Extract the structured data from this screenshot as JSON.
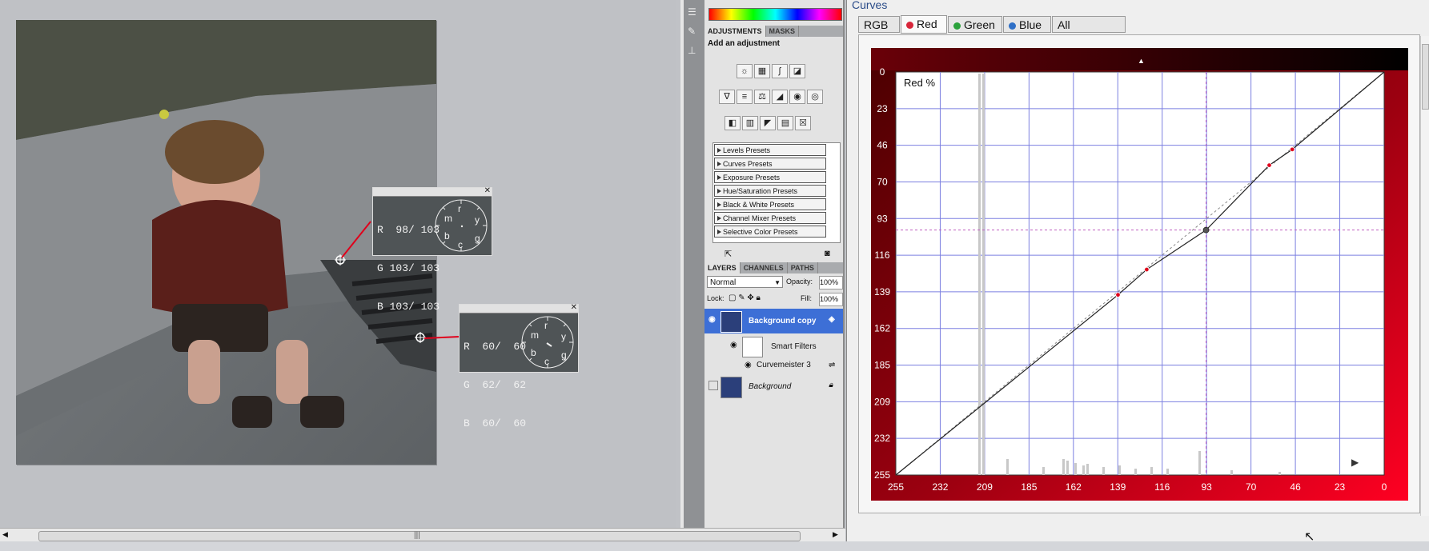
{
  "probes": [
    {
      "r": "R  98/ 103",
      "g": "G 103/ 103",
      "b": "B 103/ 103",
      "letters": [
        "m",
        "r",
        "y",
        "b",
        "c",
        "g"
      ]
    },
    {
      "r": "R  60/  60",
      "g": "G  62/  62",
      "b": "B  60/  60",
      "letters": [
        "m",
        "r",
        "y",
        "b",
        "c",
        "g"
      ]
    }
  ],
  "panels": {
    "adj_tabs": [
      "ADJUSTMENTS",
      "MASKS"
    ],
    "add_adjustment": "Add an adjustment",
    "presets": [
      "Levels Presets",
      "Curves Presets",
      "Exposure Presets",
      "Hue/Saturation Presets",
      "Black & White Presets",
      "Channel Mixer Presets",
      "Selective Color Presets"
    ],
    "layer_tabs": [
      "LAYERS",
      "CHANNELS",
      "PATHS"
    ],
    "blend_mode": "Normal",
    "opacity_label": "Opacity:",
    "opacity_value": "100%",
    "lock_label": "Lock:",
    "fill_label": "Fill:",
    "fill_value": "100%",
    "layers": [
      "Background copy",
      "Smart Filters",
      "Curvemeister 3",
      "Background"
    ]
  },
  "curves": {
    "title": "Curves",
    "tabs": [
      {
        "label": "RGB",
        "dot": ""
      },
      {
        "label": "Red",
        "dot": "#d8263a"
      },
      {
        "label": "Green",
        "dot": "#2aa13b"
      },
      {
        "label": "Blue",
        "dot": "#2f6fc6"
      },
      {
        "label": "All",
        "dot": ""
      }
    ],
    "active_tab": "Red",
    "channel_label": "Red %",
    "y_ticks": [
      "0",
      "23",
      "46",
      "70",
      "93",
      "116",
      "139",
      "162",
      "185",
      "209",
      "232",
      "255"
    ],
    "x_ticks": [
      "255",
      "232",
      "209",
      "185",
      "162",
      "139",
      "116",
      "93",
      "70",
      "46",
      "23",
      "0"
    ]
  },
  "colors": {
    "accent_red": "#e0001b",
    "grid": "#7b7fe0",
    "layer_selected": "#3d6fd6"
  },
  "chart_data": {
    "type": "line",
    "title": "",
    "xlabel": "",
    "ylabel": "Red %",
    "xlim": [
      255,
      0
    ],
    "ylim": [
      0,
      255
    ],
    "series": [
      {
        "x": [
          255,
          139,
          124,
          93,
          60,
          48,
          0
        ],
        "y": [
          255,
          141,
          125,
          100,
          59,
          49,
          0
        ]
      }
    ],
    "control_points": [
      {
        "x": 139,
        "y": 141
      },
      {
        "x": 124,
        "y": 125
      },
      {
        "x": 93,
        "y": 100
      },
      {
        "x": 60,
        "y": 59
      },
      {
        "x": 48,
        "y": 49
      }
    ],
    "selected_point": {
      "x": 93,
      "y": 100
    },
    "grid": true
  }
}
